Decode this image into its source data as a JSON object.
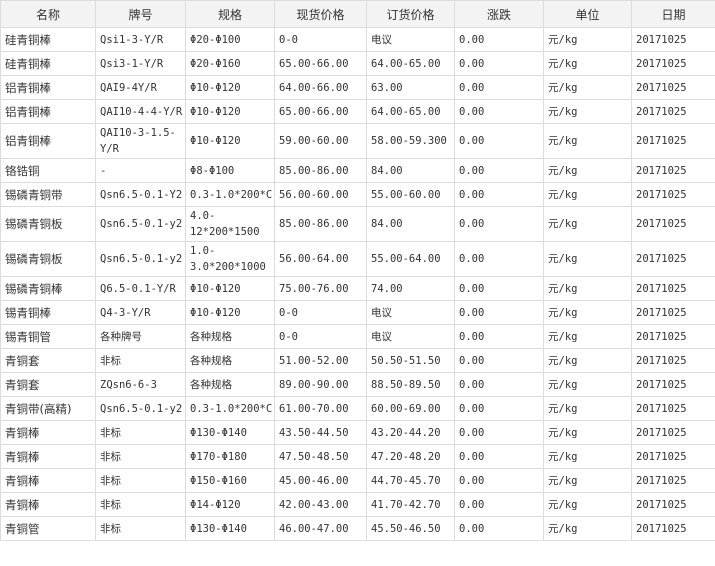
{
  "headers": [
    "名称",
    "牌号",
    "规格",
    "现货价格",
    "订货价格",
    "涨跌",
    "单位",
    "日期"
  ],
  "rows": [
    [
      "硅青铜棒",
      "Qsi1-3-Y/R",
      "Φ20-Φ100",
      "0-0",
      "电议",
      "0.00",
      "元/kg",
      "20171025"
    ],
    [
      "硅青铜棒",
      "Qsi3-1-Y/R",
      "Φ20-Φ160",
      "65.00-66.00",
      "64.00-65.00",
      "0.00",
      "元/kg",
      "20171025"
    ],
    [
      "铝青铜棒",
      "QAI9-4Y/R",
      "Φ10-Φ120",
      "64.00-66.00",
      "63.00",
      "0.00",
      "元/kg",
      "20171025"
    ],
    [
      "铝青铜棒",
      "QAI10-4-4-Y/R",
      "Φ10-Φ120",
      "65.00-66.00",
      "64.00-65.00",
      "0.00",
      "元/kg",
      "20171025"
    ],
    [
      "铝青铜棒",
      "QAI10-3-1.5-\nY/R",
      "Φ10-Φ120",
      "59.00-60.00",
      "58.00-59.300",
      "0.00",
      "元/kg",
      "20171025"
    ],
    [
      "铬锆铜",
      "-",
      "Φ8-Φ100",
      "85.00-86.00",
      "84.00",
      "0.00",
      "元/kg",
      "20171025"
    ],
    [
      "锡磷青铜带",
      "Qsn6.5-0.1-Y2",
      "0.3-1.0*200*C",
      "56.00-60.00",
      "55.00-60.00",
      "0.00",
      "元/kg",
      "20171025"
    ],
    [
      "锡磷青铜板",
      "Qsn6.5-0.1-y2",
      "4.0-\n12*200*1500",
      "85.00-86.00",
      "84.00",
      "0.00",
      "元/kg",
      "20171025"
    ],
    [
      "锡磷青铜板",
      "Qsn6.5-0.1-y2",
      "1.0-\n3.0*200*1000",
      "56.00-64.00",
      "55.00-64.00",
      "0.00",
      "元/kg",
      "20171025"
    ],
    [
      "锡磷青铜棒",
      "Q6.5-0.1-Y/R",
      "Φ10-Φ120",
      "75.00-76.00",
      "74.00",
      "0.00",
      "元/kg",
      "20171025"
    ],
    [
      "锡青铜棒",
      "Q4-3-Y/R",
      "Φ10-Φ120",
      "0-0",
      "电议",
      "0.00",
      "元/kg",
      "20171025"
    ],
    [
      "锡青铜管",
      "各种牌号",
      "各种规格",
      "0-0",
      "电议",
      "0.00",
      "元/kg",
      "20171025"
    ],
    [
      "青铜套",
      "非标",
      "各种规格",
      "51.00-52.00",
      "50.50-51.50",
      "0.00",
      "元/kg",
      "20171025"
    ],
    [
      "青铜套",
      "ZQsn6-6-3",
      "各种规格",
      "89.00-90.00",
      "88.50-89.50",
      "0.00",
      "元/kg",
      "20171025"
    ],
    [
      "青铜带(高精)",
      "Qsn6.5-0.1-y2",
      "0.3-1.0*200*C",
      "61.00-70.00",
      "60.00-69.00",
      "0.00",
      "元/kg",
      "20171025"
    ],
    [
      "青铜棒",
      "非标",
      "Φ130-Φ140",
      "43.50-44.50",
      "43.20-44.20",
      "0.00",
      "元/kg",
      "20171025"
    ],
    [
      "青铜棒",
      "非标",
      "Φ170-Φ180",
      "47.50-48.50",
      "47.20-48.20",
      "0.00",
      "元/kg",
      "20171025"
    ],
    [
      "青铜棒",
      "非标",
      "Φ150-Φ160",
      "45.00-46.00",
      "44.70-45.70",
      "0.00",
      "元/kg",
      "20171025"
    ],
    [
      "青铜棒",
      "非标",
      "Φ14-Φ120",
      "42.00-43.00",
      "41.70-42.70",
      "0.00",
      "元/kg",
      "20171025"
    ],
    [
      "青铜管",
      "非标",
      "Φ130-Φ140",
      "46.00-47.00",
      "45.50-46.50",
      "0.00",
      "元/kg",
      "20171025"
    ]
  ]
}
